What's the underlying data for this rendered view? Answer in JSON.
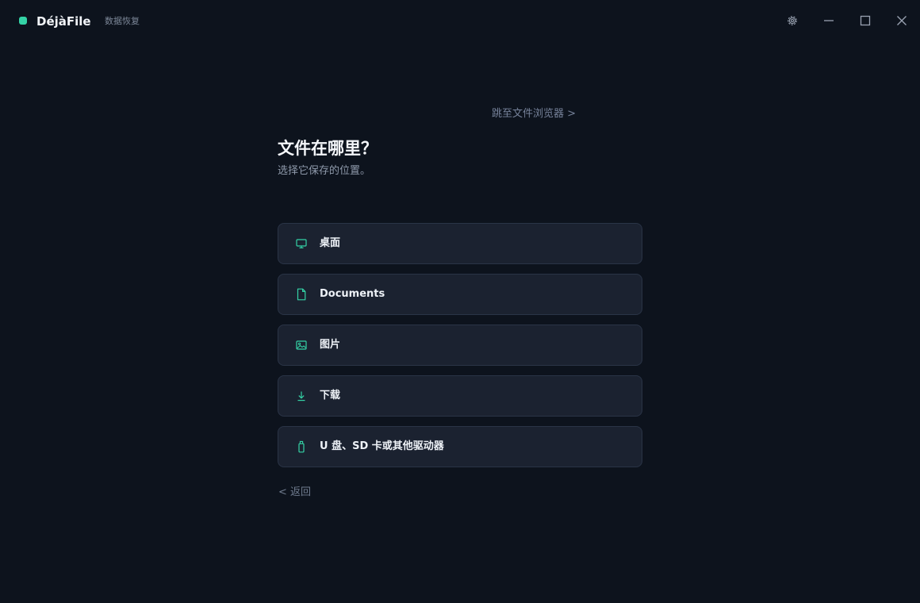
{
  "app": {
    "name": "DéjàFile",
    "subtitle": "数据恢复",
    "brand_color": "#34d3a6"
  },
  "window_controls": {
    "settings_icon": "gear-icon",
    "minimize_icon": "minimize-icon",
    "maximize_icon": "maximize-icon",
    "close_icon": "close-icon"
  },
  "main": {
    "jump_link": "跳至文件浏览器 >",
    "title": "文件在哪里？",
    "subtitle": "选择它保存的位置。",
    "options": [
      {
        "label": "桌面",
        "icon": "monitor-icon"
      },
      {
        "label": "Documents",
        "icon": "document-icon"
      },
      {
        "label": "图片",
        "icon": "image-icon"
      },
      {
        "label": "下载",
        "icon": "download-icon"
      },
      {
        "label": "U 盘、SD 卡或其他驱动器",
        "icon": "usb-drive-icon"
      }
    ],
    "back_link": "< 返回"
  },
  "colors": {
    "background": "#0d131d",
    "card": "#1b2230",
    "card_border": "#2a3446",
    "accent": "#34d3a6"
  }
}
